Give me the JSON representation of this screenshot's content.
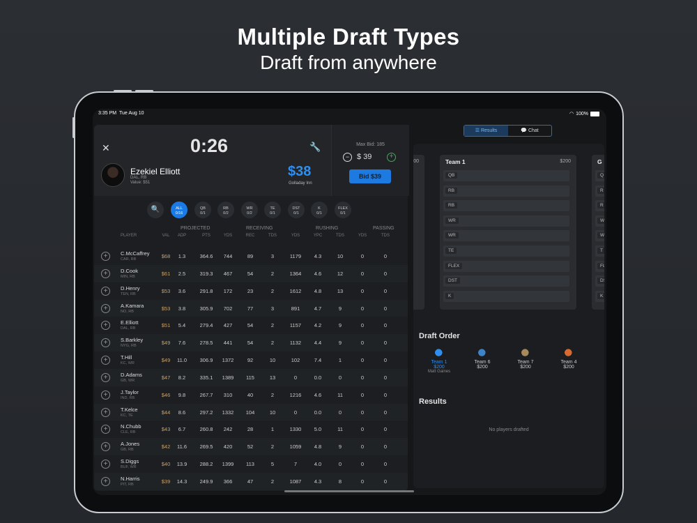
{
  "marketing": {
    "title": "Multiple Draft Types",
    "subtitle": "Draft from anywhere"
  },
  "status": {
    "time": "3:35 PM",
    "date": "Tue Aug 10",
    "battery": "100%"
  },
  "draft": {
    "timer": "0:26",
    "player": {
      "name": "Ezekiel Elliott",
      "team": "DAL, RB",
      "value": "Value: $51"
    },
    "current_bid": "$38",
    "bidder": "Golladay Inn",
    "max_bid": "Max Bid: 185",
    "bid_amount": "$ 39",
    "bid_button": "Bid $39"
  },
  "filters": [
    {
      "label": "ALL",
      "count": "0/16",
      "active": true
    },
    {
      "label": "QB",
      "count": "0/1"
    },
    {
      "label": "RB",
      "count": "0/2"
    },
    {
      "label": "WR",
      "count": "0/2"
    },
    {
      "label": "TE",
      "count": "0/1"
    },
    {
      "label": "DST",
      "count": "0/1"
    },
    {
      "label": "K",
      "count": "0/1"
    },
    {
      "label": "FLEX",
      "count": "0/1"
    }
  ],
  "groups": {
    "projected": "PROJECTED",
    "receiving": "RECEIVING",
    "rushing": "RUSHING",
    "passing": "PASSING"
  },
  "columns": [
    "PLAYER",
    "VAL",
    "ADP",
    "PTS",
    "YDS",
    "REC",
    "TDS",
    "YDS",
    "YPC",
    "TDS",
    "YDS",
    "TDS"
  ],
  "players": [
    [
      "C.McCaffrey",
      "CAR, RB",
      "$68",
      "1.3",
      "364.6",
      "744",
      "89",
      "3",
      "1179",
      "4.3",
      "10",
      "0",
      "0"
    ],
    [
      "D.Cook",
      "MIN, RB",
      "$61",
      "2.5",
      "319.3",
      "467",
      "54",
      "2",
      "1364",
      "4.6",
      "12",
      "0",
      "0"
    ],
    [
      "D.Henry",
      "TEN, RB",
      "$53",
      "3.6",
      "291.8",
      "172",
      "23",
      "2",
      "1612",
      "4.8",
      "13",
      "0",
      "0"
    ],
    [
      "A.Kamara",
      "NO, RB",
      "$53",
      "3.8",
      "305.9",
      "702",
      "77",
      "3",
      "891",
      "4.7",
      "9",
      "0",
      "0"
    ],
    [
      "E.Elliott",
      "DAL, RB",
      "$51",
      "5.4",
      "279.4",
      "427",
      "54",
      "2",
      "1157",
      "4.2",
      "9",
      "0",
      "0"
    ],
    [
      "S.Barkley",
      "NYG, RB",
      "$49",
      "7.6",
      "278.5",
      "441",
      "54",
      "2",
      "1132",
      "4.4",
      "9",
      "0",
      "0"
    ],
    [
      "T.Hill",
      "KC, WR",
      "$49",
      "11.0",
      "306.9",
      "1372",
      "92",
      "10",
      "102",
      "7.4",
      "1",
      "0",
      "0"
    ],
    [
      "D.Adams",
      "GB, WR",
      "$47",
      "8.2",
      "335.1",
      "1389",
      "115",
      "13",
      "0",
      "0.0",
      "0",
      "0",
      "0"
    ],
    [
      "J.Taylor",
      "IND, RB",
      "$46",
      "9.8",
      "267.7",
      "310",
      "40",
      "2",
      "1216",
      "4.6",
      "11",
      "0",
      "0"
    ],
    [
      "T.Kelce",
      "KC, TE",
      "$44",
      "8.6",
      "297.2",
      "1332",
      "104",
      "10",
      "0",
      "0.0",
      "0",
      "0",
      "0"
    ],
    [
      "N.Chubb",
      "CLE, RB",
      "$43",
      "6.7",
      "260.8",
      "242",
      "28",
      "1",
      "1330",
      "5.0",
      "11",
      "0",
      "0"
    ],
    [
      "A.Jones",
      "GB, RB",
      "$42",
      "11.6",
      "269.5",
      "420",
      "52",
      "2",
      "1059",
      "4.8",
      "9",
      "0",
      "0"
    ],
    [
      "S.Diggs",
      "BUF, WR",
      "$40",
      "13.9",
      "288.2",
      "1399",
      "113",
      "5",
      "7",
      "4.0",
      "0",
      "0",
      "0"
    ],
    [
      "N.Harris",
      "PIT, RB",
      "$39",
      "14.3",
      "249.9",
      "366",
      "47",
      "2",
      "1087",
      "4.3",
      "8",
      "0",
      "0"
    ]
  ],
  "right": {
    "tabs": {
      "results": "Results",
      "chat": "Chat"
    },
    "left_card_budget": "00",
    "team_card": {
      "title": "Team 1",
      "budget": "$200",
      "slots": [
        "QB",
        "RB",
        "RB",
        "WR",
        "WR",
        "TE",
        "FLEX",
        "DST",
        "K"
      ]
    },
    "right_card": {
      "title": "G",
      "slots": [
        "Q",
        "R",
        "R",
        "W",
        "W",
        "T",
        "FL",
        "DS",
        "K"
      ]
    },
    "draft_order_title": "Draft Order",
    "draft_order": [
      {
        "team": "Team 1",
        "budget": "$200",
        "owner": "Matt Gaines",
        "color": "#2e8ff0"
      },
      {
        "team": "Team 6",
        "budget": "$200",
        "owner": "",
        "color": "#3b84c9"
      },
      {
        "team": "Team 7",
        "budget": "$200",
        "owner": "",
        "color": "#a88a5a"
      },
      {
        "team": "Team 4",
        "budget": "$200",
        "owner": "",
        "color": "#d9692f"
      }
    ],
    "results_title": "Results",
    "no_players": "No players drafted"
  }
}
